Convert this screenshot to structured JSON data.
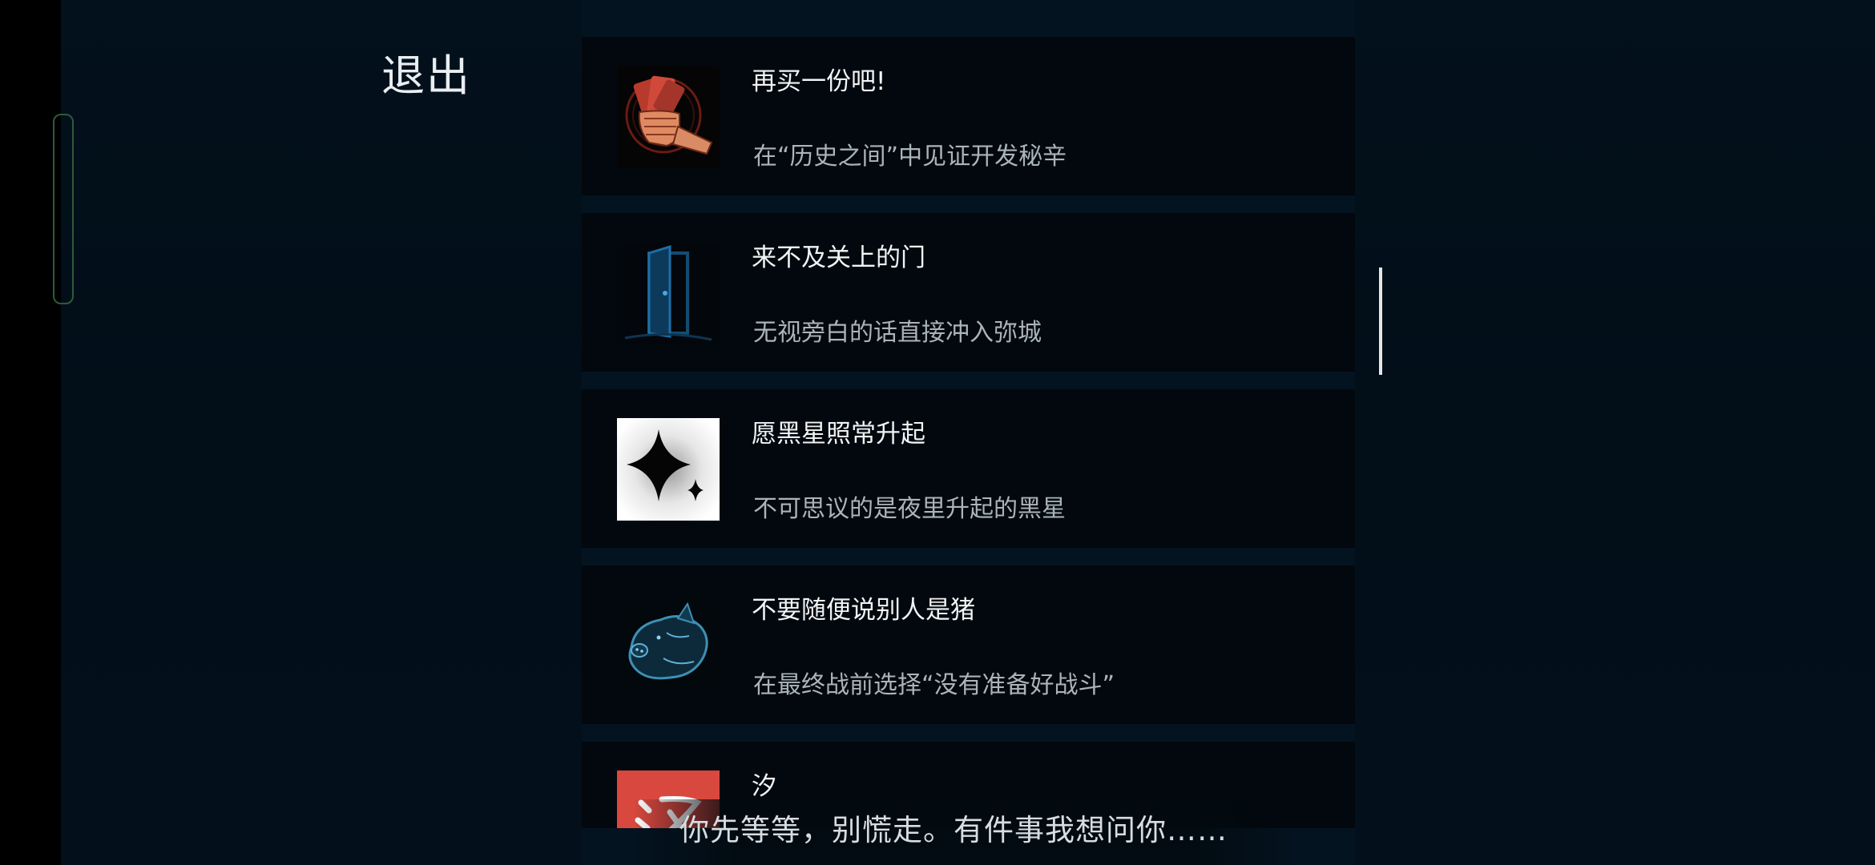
{
  "menu": {
    "exit_label": "退出"
  },
  "achievements": [
    {
      "title": "再买一份吧!",
      "description": "在“历史之间”中见证开发秘辛",
      "icon": "fist-with-cash-icon"
    },
    {
      "title": "来不及关上的门",
      "description": "无视旁白的话直接冲入弥城",
      "icon": "open-door-icon"
    },
    {
      "title": "愿黑星照常升起",
      "description": "不可思议的是夜里升起的黑星",
      "icon": "black-star-icon"
    },
    {
      "title": "不要随便说别人是猪",
      "description": "在最终战前选择“没有准备好战斗”",
      "icon": "pig-icon"
    },
    {
      "title": "汐",
      "description": "",
      "icon": "xi-character-icon"
    }
  ],
  "dialogue": {
    "subtitle": "你先等等，别慌走。有件事我想问你……"
  },
  "colors": {
    "background": "#030f1a",
    "card": "#02080d",
    "title_text": "#f1f4f6",
    "desc_text": "#aab4bb",
    "door_accent": "#1d6fa8",
    "fist_accent": "#c8402e",
    "pig_accent": "#3e8fb5",
    "xi_accent": "#d9483e"
  }
}
